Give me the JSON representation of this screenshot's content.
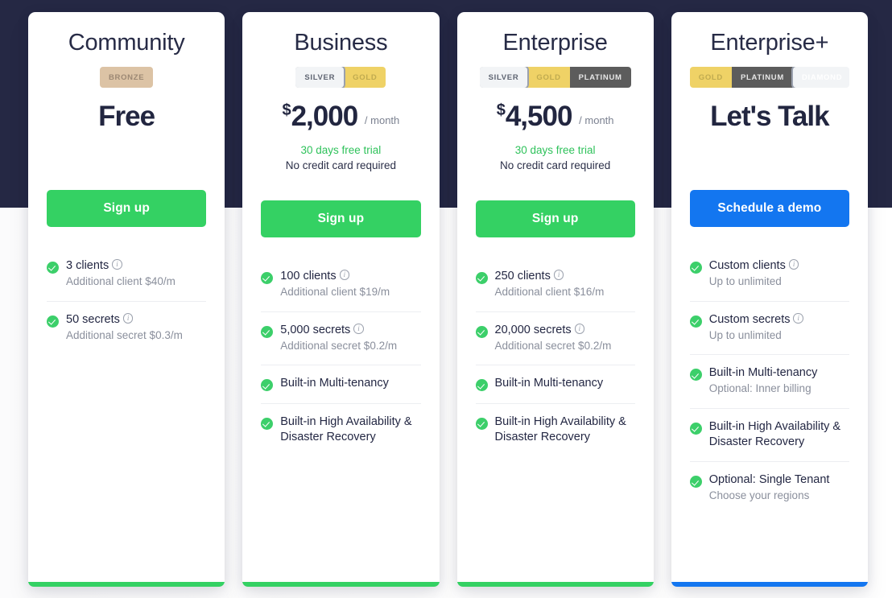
{
  "theme": {
    "band_color": "#252844",
    "green": "#34d163",
    "blue": "#1376f0",
    "trial_green": "#2fc25b"
  },
  "plans": [
    {
      "name": "Community",
      "tiers": [
        {
          "label": "BRONZE",
          "style": "bronze",
          "active": false
        }
      ],
      "price": {
        "currency": "",
        "amount": "Free",
        "period": ""
      },
      "trial": "",
      "no_credit_card": "",
      "cta": {
        "label": "Sign up",
        "style": "green"
      },
      "accent": "#34d163",
      "features": [
        {
          "main": "3 clients",
          "info": true,
          "sub": "Additional client $40/m"
        },
        {
          "main": "50 secrets",
          "info": true,
          "sub": "Additional secret $0.3/m"
        }
      ]
    },
    {
      "name": "Business",
      "tiers": [
        {
          "label": "SILVER",
          "style": "silver",
          "active": true
        },
        {
          "label": "GOLD",
          "style": "gold",
          "active": false
        }
      ],
      "price": {
        "currency": "$",
        "amount": "2,000",
        "period": "/ month"
      },
      "trial": "30 days free trial",
      "no_credit_card": "No credit card required",
      "cta": {
        "label": "Sign up",
        "style": "green"
      },
      "accent": "#34d163",
      "features": [
        {
          "main": "100 clients",
          "info": true,
          "sub": "Additional client $19/m"
        },
        {
          "main": "5,000 secrets",
          "info": true,
          "sub": "Additional secret $0.2/m"
        },
        {
          "main": "Built-in Multi-tenancy",
          "info": false,
          "sub": ""
        },
        {
          "main": "Built-in High Availability & Disaster Recovery",
          "info": false,
          "sub": ""
        }
      ]
    },
    {
      "name": "Enterprise",
      "tiers": [
        {
          "label": "SILVER",
          "style": "silver",
          "active": true
        },
        {
          "label": "GOLD",
          "style": "gold",
          "active": false
        },
        {
          "label": "PLATINUM",
          "style": "platinum",
          "active": false
        }
      ],
      "price": {
        "currency": "$",
        "amount": "4,500",
        "period": "/ month"
      },
      "trial": "30 days free trial",
      "no_credit_card": "No credit card required",
      "cta": {
        "label": "Sign up",
        "style": "green"
      },
      "accent": "#34d163",
      "features": [
        {
          "main": "250 clients",
          "info": true,
          "sub": "Additional client $16/m"
        },
        {
          "main": "20,000 secrets",
          "info": true,
          "sub": "Additional secret $0.2/m"
        },
        {
          "main": "Built-in Multi-tenancy",
          "info": false,
          "sub": ""
        },
        {
          "main": "Built-in High Availability & Disaster Recovery",
          "info": false,
          "sub": ""
        }
      ]
    },
    {
      "name": "Enterprise+",
      "tiers": [
        {
          "label": "GOLD",
          "style": "gold",
          "active": false
        },
        {
          "label": "PLATINUM",
          "style": "platinum",
          "active": false
        },
        {
          "label": "DIAMOND",
          "style": "diamond",
          "active": true
        }
      ],
      "price": {
        "currency": "",
        "amount": "Let's Talk",
        "period": ""
      },
      "trial": "",
      "no_credit_card": "",
      "cta": {
        "label": "Schedule a demo",
        "style": "blue"
      },
      "accent": "#1376f0",
      "features": [
        {
          "main": "Custom clients",
          "info": true,
          "sub": "Up to unlimited"
        },
        {
          "main": "Custom secrets",
          "info": true,
          "sub": "Up to unlimited"
        },
        {
          "main": "Built-in Multi-tenancy",
          "info": false,
          "sub": "Optional: Inner billing"
        },
        {
          "main": "Built-in High Availability & Disaster Recovery",
          "info": false,
          "sub": ""
        },
        {
          "main": "Optional: Single Tenant",
          "info": false,
          "sub": "Choose your regions"
        }
      ]
    }
  ]
}
